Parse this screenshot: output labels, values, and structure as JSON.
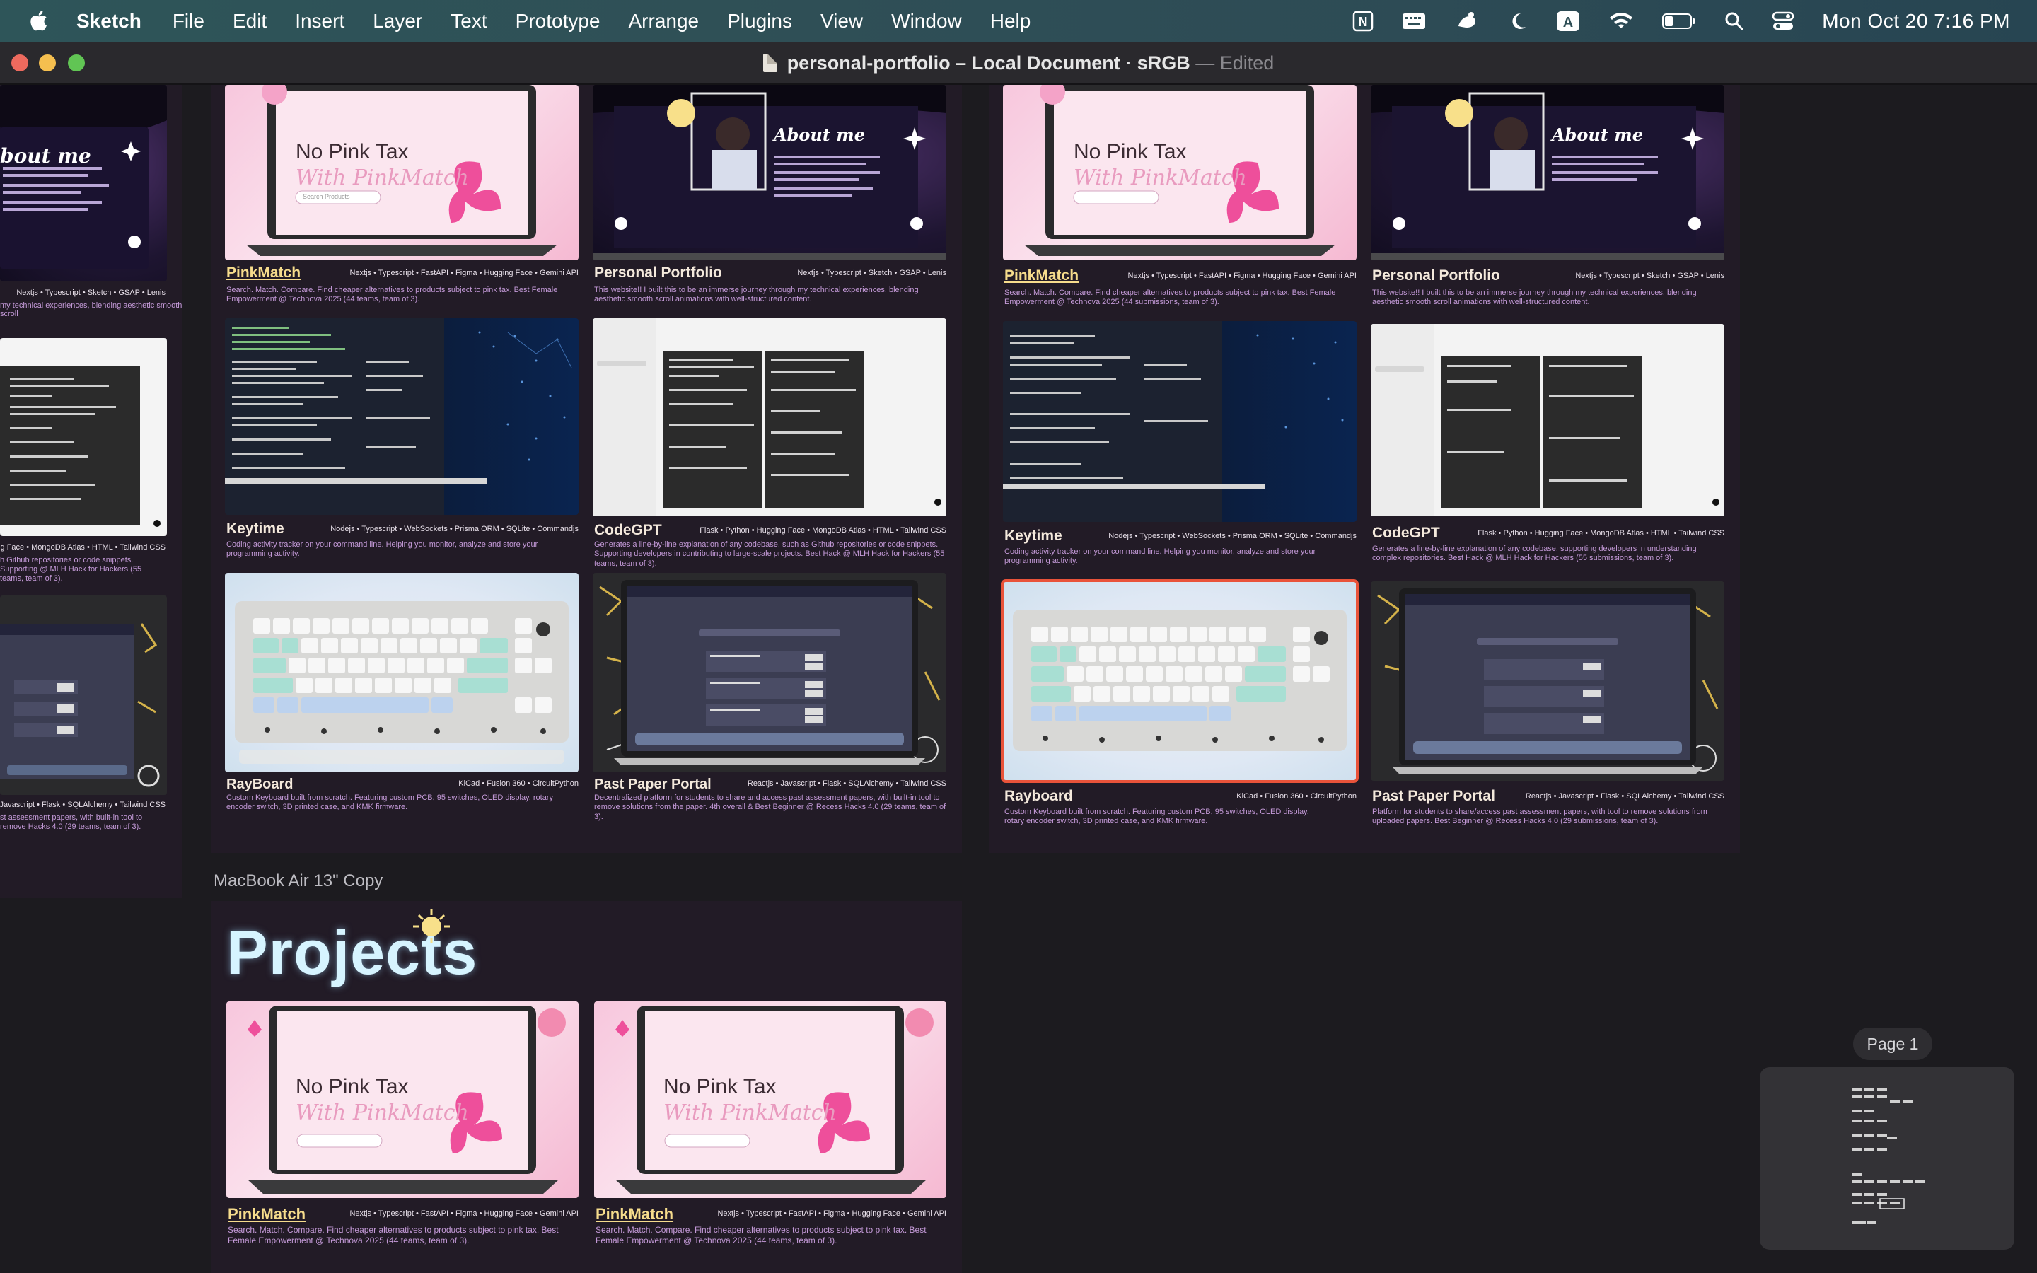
{
  "menubar": {
    "app": "Sketch",
    "menus": [
      "File",
      "Edit",
      "Insert",
      "Layer",
      "Text",
      "Prototype",
      "Arrange",
      "Plugins",
      "View",
      "Window",
      "Help"
    ],
    "status_icons": [
      "notion-icon",
      "keyboard-icon",
      "stage-manager-icon",
      "moon-icon",
      "input-source-icon",
      "wifi-icon",
      "battery-icon",
      "spotlight-icon",
      "control-center-icon"
    ],
    "input_source": "A",
    "notion_letter": "N",
    "clock": "Mon Oct 20  7:16 PM"
  },
  "window": {
    "title": "personal-portfolio – Local Document · sRGB",
    "edited": "— Edited"
  },
  "artboards": {
    "copy_label": "MacBook Air 13\" Copy",
    "projects_heading": "Projects"
  },
  "projects": {
    "pinkmatch": {
      "title": "PinkMatch",
      "tags": "Nextjs • Typescript • FastAPI • Figma • Hugging Face • Gemini API",
      "desc": "Search. Match. Compare. Find cheaper alternatives to products subject to pink tax. Best Female Empowerment @ Technova 2025 (44 teams, team of 3).",
      "desc_right": "Search. Match. Compare. Find cheaper alternatives to products subject to pink tax. Best Female Empowerment @ Technova 2025 (44 submissions, team of 3).",
      "thumb_line1": "No Pink Tax",
      "thumb_line2": "With PinkMatch",
      "thumb_search": "Search Products"
    },
    "portfolio": {
      "title": "Personal Portfolio",
      "tags": "Nextjs • Typescript • Sketch • GSAP • Lenis",
      "desc": "This website!! I built this to be an immerse journey through my technical experiences, blending aesthetic smooth scroll animations with well-structured content.",
      "thumb_heading": "About me"
    },
    "keytime": {
      "title": "Keytime",
      "tags": "Nodejs • Typescript • WebSockets • Prisma ORM • SQLite • Commandjs",
      "desc": "Coding activity tracker on your command line. Helping you monitor, analyze and store your programming activity."
    },
    "codegpt": {
      "title": "CodeGPT",
      "tags": "Flask • Python • Hugging Face • MongoDB Atlas • HTML • Tailwind CSS",
      "desc": "Generates a line-by-line explanation of any codebase, such as Github repositories or code snippets. Supporting developers in contributing to large-scale projects. Best Hack @ MLH Hack for Hackers (55 teams, team of 3).",
      "desc_right": "Generates a line-by-line explanation of any codebase, supporting developers in understanding complex repositories. Best Hack @ MLH Hack for Hackers (55 submissions, team of 3)."
    },
    "rayboard": {
      "title": "RayBoard",
      "title_right": "Rayboard",
      "tags": "KiCad • Fusion 360 • CircuitPython",
      "desc": "Custom Keyboard built from scratch. Featuring custom PCB, 95 switches, OLED display, rotary encoder switch, 3D printed case, and KMK firmware.",
      "desc_right": "Custom Keyboard built from scratch. Featuring custom PCB, 95 switches, OLED display, rotary encoder switch, 3D printed case, and KMK firmware."
    },
    "pastpaper": {
      "title": "Past Paper Portal",
      "tags": "Reactjs • Javascript • Flask • SQLAlchemy • Tailwind CSS",
      "desc": "Decentralized platform for students to share and access past assessment papers, with built-in tool to remove solutions from the paper. 4th overall & Best Beginner @ Recess Hacks 4.0 (29 teams, team of 3).",
      "desc_right": "Platform for students to share/access past assessment papers, with tool to remove solutions from uploaded papers. Best Beginner @ Recess Hacks 4.0 (29 submissions, team of 3)."
    },
    "left_partial": {
      "tags_1": "Nextjs • Typescript • Sketch • GSAP • Lenis",
      "desc_1": "my technical experiences, blending aesthetic smooth scroll",
      "tags_2": "ngging Face • MongoDB Atlas • HTML • Tailwind CSS",
      "desc_2": "h Github repositories or code snippets. Supporting @ MLH Hack for Hackers (55 teams, team of 3).",
      "tags_3": "t • Javascript • Flask • SQLAlchemy • Tailwind CSS",
      "desc_3": "st assessment papers, with built-in tool to remove Hacks 4.0 (29 teams, team of 3).",
      "thumb_heading": "bout me"
    }
  },
  "minimap": {
    "page": "Page 1"
  },
  "colors": {
    "accent_selection": "#e9533a",
    "title_link": "#f6dc8c",
    "desc": "#c49ad8",
    "artboard_bg": "#221b26",
    "canvas_bg": "#1c1b1f"
  }
}
